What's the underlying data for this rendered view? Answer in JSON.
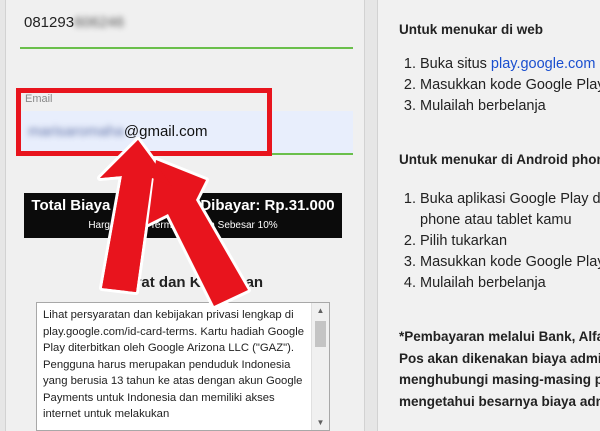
{
  "form": {
    "phone_prefix": "081293",
    "phone_masked": "606246",
    "email_label": "Email",
    "email_masked": "marisaromaha",
    "email_domain": "@gmail.com",
    "total_main": "Total Biaya yang Harus Dibayar: Rp.31.000",
    "total_sub": "Harga Sudah Termasuk PPn Sebesar 10%",
    "terms_title": "Syarat dan Ketentuan",
    "terms_text": "Lihat persyaratan dan kebijakan privasi lengkap di play.google.com/id-card-terms. Kartu hadiah Google Play diterbitkan oleh Google Arizona LLC (\"GAZ\"). Pengguna harus merupakan penduduk Indonesia yang berusia 13 tahun ke atas dengan akun Google Payments untuk Indonesia dan memiliki akses internet untuk melakukan"
  },
  "instructions": {
    "web_heading": "Untuk menukar di web",
    "web_steps": [
      {
        "pre": "Buka situs ",
        "link": "play.google.com"
      },
      {
        "pre": "Masukkan kode Google Play",
        "link": ""
      },
      {
        "pre": "Mulailah berbelanja",
        "link": ""
      }
    ],
    "android_heading": "Untuk menukar di Android phone",
    "android_steps": [
      "Buka aplikasi Google Play di",
      "phone atau tablet kamu",
      "Pilih tukarkan",
      "Masukkan kode Google Play",
      "Mulailah berbelanja"
    ],
    "payment_note": [
      "*Pembayaran melalui Bank, Alfamart dan",
      "Pos akan dikenakan biaya administrasi,",
      "menghubungi masing-masing pihak untuk",
      "mengetahui besarnya biaya administrasi"
    ]
  },
  "colors": {
    "highlight": "#e8141d",
    "field_underline": "#6abf4b",
    "link": "#1a4fcf"
  }
}
